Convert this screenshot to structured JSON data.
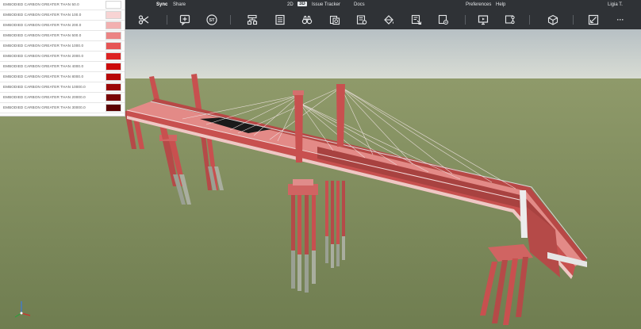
{
  "menu": {
    "sync": "Sync",
    "share": "Share",
    "view_2d": "2D",
    "view_3d": "3D",
    "issue_tracker": "Issue Tracker",
    "docs": "Docs",
    "preferences": "Preferences",
    "help": "Help",
    "user": "Ligia T."
  },
  "toolbar": {
    "icons": [
      "scissors-icon",
      "add-comment-icon",
      "st-icon",
      "tree-icon",
      "properties-icon",
      "binoculars-icon",
      "sheets-icon",
      "measure-icon",
      "paint-bucket-icon",
      "filter-icon",
      "clip-icon",
      "screen-icon",
      "cut-icon",
      "box-icon",
      "section-icon",
      "more-icon"
    ],
    "st_label": "ST",
    "more_label": "···"
  },
  "legend": {
    "items": [
      {
        "label": "EMBODIED CARBON GREATER THAN 50.0",
        "color": "#ffffff"
      },
      {
        "label": "EMBODIED CARBON GREATER THAN 100.0",
        "color": "#f8d4d4"
      },
      {
        "label": "EMBODIED CARBON GREATER THAN 200.0",
        "color": "#f2b0b0"
      },
      {
        "label": "EMBODIED CARBON GREATER THAN 500.0",
        "color": "#ec8484"
      },
      {
        "label": "EMBODIED CARBON GREATER THAN 1000.0",
        "color": "#e65555"
      },
      {
        "label": "EMBODIED CARBON GREATER THAN 2000.0",
        "color": "#dd2222"
      },
      {
        "label": "EMBODIED CARBON GREATER THAN 4000.0",
        "color": "#cc0a0a"
      },
      {
        "label": "EMBODIED CARBON GREATER THAN 8000.0",
        "color": "#b80808"
      },
      {
        "label": "EMBODIED CARBON GREATER THAN 10000.0",
        "color": "#9c0606"
      },
      {
        "label": "EMBODIED CARBON GREATER THAN 20000.0",
        "color": "#7a0404"
      },
      {
        "label": "EMBODIED CARBON GREATER THAN 30000.0",
        "color": "#5c0202"
      }
    ]
  },
  "colors": {
    "toolbar_bg": "#2f3236",
    "bridge_red": "#c8504f",
    "bridge_light": "#e07a78",
    "pile_grey": "#9aa093",
    "ground": "#7d8a5c",
    "sky_top": "#b9c2c6"
  }
}
